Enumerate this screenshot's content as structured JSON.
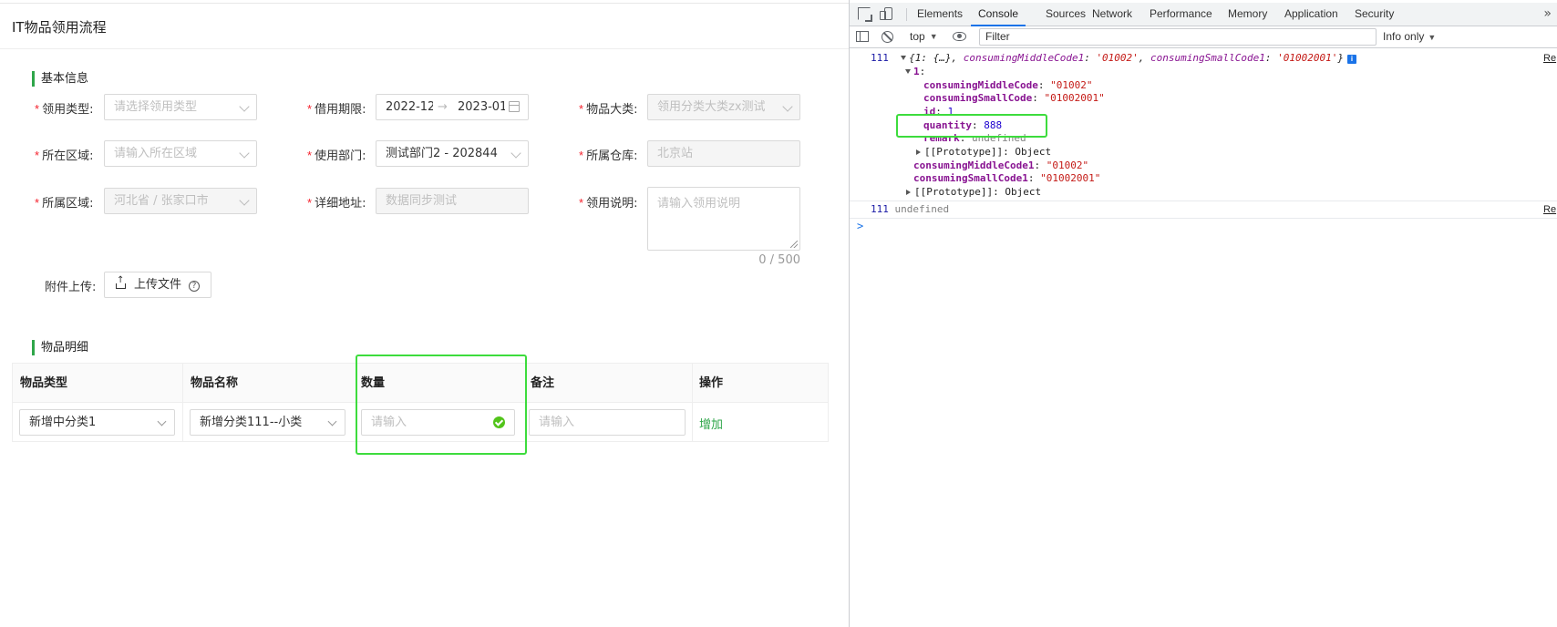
{
  "app": {
    "page_title": "IT物品领用流程",
    "basic_section_title": "基本信息",
    "detail_section_title": "物品明细",
    "fields": {
      "collect_type": {
        "label": "领用类型:",
        "placeholder": "请选择领用类型"
      },
      "borrow_period": {
        "label": "借用期限:",
        "start": "2022-12",
        "end": "2023-01",
        "separator": "→"
      },
      "item_category": {
        "label": "物品大类:",
        "value": "领用分类大类zx测试"
      },
      "region": {
        "label": "所在区域:",
        "placeholder": "请输入所在区域"
      },
      "department": {
        "label": "使用部门:",
        "value": "测试部门2 - 202844"
      },
      "warehouse": {
        "label": "所属仓库:",
        "value": "北京站"
      },
      "belong_area": {
        "label": "所属区域:",
        "value": "河北省 / 张家口市"
      },
      "address": {
        "label": "详细地址:",
        "value": "数据同步测试"
      },
      "description": {
        "label": "领用说明:",
        "placeholder": "请输入领用说明",
        "counter": "0 / 500"
      },
      "attachment": {
        "label": "附件上传:",
        "button_label": "上传文件",
        "help_glyph": "?"
      }
    },
    "required_mark": "*",
    "table": {
      "headers": [
        "物品类型",
        "物品名称",
        "数量",
        "备注",
        "操作"
      ],
      "row": {
        "item_type": "新增中分类1",
        "item_name": "新增分类111--小类",
        "quantity_placeholder": "请输入",
        "remark_placeholder": "请输入",
        "action": "增加"
      }
    }
  },
  "devtools": {
    "tabs": [
      "Elements",
      "Console",
      "Sources",
      "Network",
      "Performance",
      "Memory",
      "Application",
      "Security"
    ],
    "active_tab": "Console",
    "more_glyph": "»",
    "context": "top",
    "filter_placeholder": "Filter",
    "log_level": "Info only",
    "console": {
      "count": "111",
      "summary_prefix": "{1: {…}, ",
      "summary_key1": "consumingMiddleCode1",
      "summary_val1": "'01002'",
      "summary_key2": "consumingSmallCode1",
      "summary_val2": "'01002001'",
      "summary_suffix": "}",
      "info_glyph": "i",
      "source_link": "Re",
      "expanded_key": "1",
      "lines": [
        {
          "key": "consumingMiddleCode",
          "value": "\"01002\"",
          "kind": "s"
        },
        {
          "key": "consumingSmallCode",
          "value": "\"01002001\"",
          "kind": "s"
        },
        {
          "key": "id",
          "value": "1",
          "kind": "n"
        },
        {
          "key": "quantity",
          "value": "888",
          "kind": "n"
        },
        {
          "key": "remark",
          "value": "undefined",
          "kind": "u"
        }
      ],
      "prototype_label": "[[Prototype]]",
      "prototype_value": "Object",
      "outer_lines": [
        {
          "key": "consumingMiddleCode1",
          "value": "\"01002\""
        },
        {
          "key": "consumingSmallCode1",
          "value": "\"01002001\""
        }
      ],
      "second_count": "111",
      "second_value": "undefined",
      "prompt_glyph": ">"
    }
  },
  "colors": {
    "accent_green": "#2fa64a",
    "highlight_green": "#3ddc3d",
    "required_red": "#f5222d",
    "devtools_blue": "#1a73e8"
  }
}
